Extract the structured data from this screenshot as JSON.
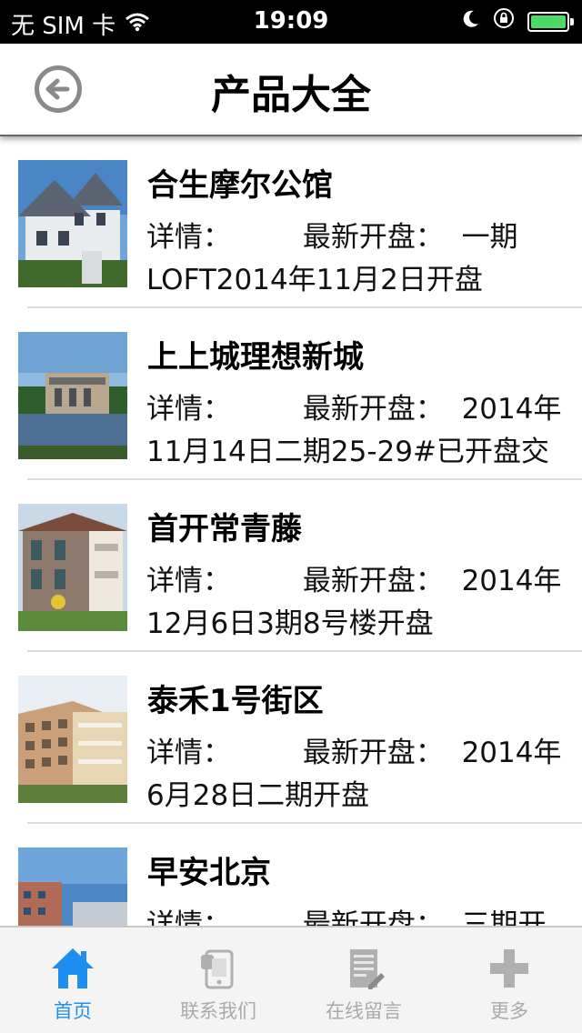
{
  "status_bar": {
    "carrier": "无 SIM 卡",
    "time": "19:09",
    "battery_color": "#4cd964"
  },
  "nav": {
    "title": "产品大全",
    "back_icon": "back-arrow-circle-icon"
  },
  "products": [
    {
      "name": "合生摩尔公馆",
      "detail_label": "详情：",
      "latest_label": "最新开盘：",
      "latest_value": "一期",
      "latest_value_line2": "LOFT2014年11月2日开盘"
    },
    {
      "name": "上上城理想新城",
      "detail_label": "详情：",
      "latest_label": "最新开盘：",
      "latest_value": "2014年",
      "latest_value_line2": "11月14日二期25-29#已开盘交"
    },
    {
      "name": "首开常青藤",
      "detail_label": "详情：",
      "latest_label": "最新开盘：",
      "latest_value": "2014年",
      "latest_value_line2": "12月6日3期8号楼开盘"
    },
    {
      "name": "泰禾1号街区",
      "detail_label": "详情：",
      "latest_label": "最新开盘：",
      "latest_value": "2014年",
      "latest_value_line2": "6月28日二期开盘"
    },
    {
      "name": "早安北京",
      "detail_label": "详情：",
      "latest_label": "最新开盘：",
      "latest_value": "三期开",
      "latest_value_line2": ""
    }
  ],
  "tabs": [
    {
      "label": "首页",
      "icon": "home-icon",
      "active": true
    },
    {
      "label": "联系我们",
      "icon": "phone-icon",
      "active": false
    },
    {
      "label": "在线留言",
      "icon": "note-icon",
      "active": false
    },
    {
      "label": "更多",
      "icon": "plus-icon",
      "active": false
    }
  ],
  "colors": {
    "tab_active": "#1e8ef0",
    "tab_inactive": "#aaaaaa"
  }
}
